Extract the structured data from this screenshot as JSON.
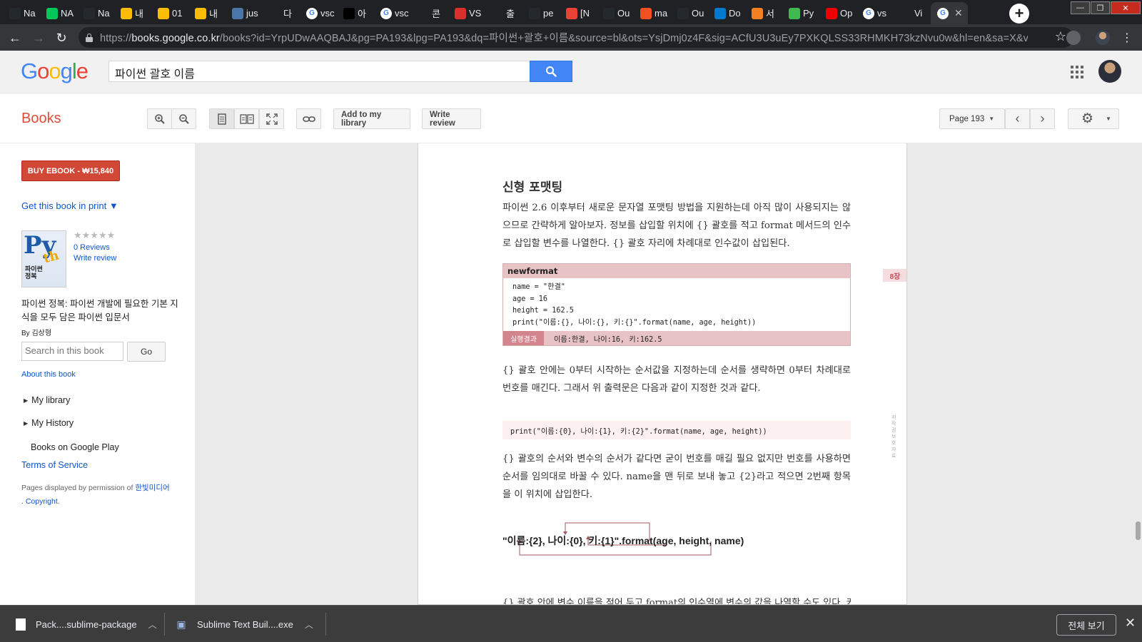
{
  "browser": {
    "tabs": [
      {
        "icon": "github-icon",
        "label": "Na",
        "color": "#24292e"
      },
      {
        "icon": "naver-icon",
        "label": "NA",
        "color": "#03c75a"
      },
      {
        "icon": "github-icon",
        "label": "Na",
        "color": "#24292e"
      },
      {
        "icon": "drive-icon",
        "label": "내",
        "color": "#fbbc04"
      },
      {
        "icon": "drive-icon",
        "label": "01",
        "color": "#fbbc04"
      },
      {
        "icon": "drive-icon",
        "label": "내",
        "color": "#fbbc04"
      },
      {
        "icon": "vk-icon",
        "label": "jus",
        "color": "#4a76a8"
      },
      {
        "icon": "download-icon",
        "label": "다",
        "color": "#202124"
      },
      {
        "icon": "google-icon",
        "label": "vsc",
        "color": "#ffffff"
      },
      {
        "icon": "dev-icon",
        "label": "아",
        "color": "#000000"
      },
      {
        "icon": "google-icon",
        "label": "vsc",
        "color": "#ffffff"
      },
      {
        "icon": "blank-icon",
        "label": "콘",
        "color": "#202124"
      },
      {
        "icon": "vs-icon",
        "label": "VS",
        "color": "#d9302c"
      },
      {
        "icon": "blank-icon",
        "label": "출",
        "color": "#202124"
      },
      {
        "icon": "github-icon",
        "label": "pe",
        "color": "#24292e"
      },
      {
        "icon": "gmail-icon",
        "label": "[N",
        "color": "#ea4335"
      },
      {
        "icon": "github-icon",
        "label": "Ou",
        "color": "#24292e"
      },
      {
        "icon": "microsoft-icon",
        "label": "ma",
        "color": "#f25022"
      },
      {
        "icon": "github-icon",
        "label": "Ou",
        "color": "#24292e"
      },
      {
        "icon": "vscode-icon",
        "label": "Do",
        "color": "#007acc"
      },
      {
        "icon": "stack-icon",
        "label": "서",
        "color": "#f48024"
      },
      {
        "icon": "py-icon",
        "label": "Py",
        "color": "#3fb950"
      },
      {
        "icon": "k-icon",
        "label": "Op",
        "color": "#e00"
      },
      {
        "icon": "google-icon",
        "label": "vs",
        "color": "#ffffff"
      },
      {
        "icon": "code-icon",
        "label": "Vi",
        "color": "#202124"
      },
      {
        "icon": "google-icon",
        "label": "",
        "color": "#ffffff",
        "active": true
      }
    ],
    "url_scheme": "https://",
    "url_host": "books.google.co.kr",
    "url_rest": "/books?id=YrpUDwAAQBAJ&pg=PA193&lpg=PA193&dq=파이썬+괄호+이름&source=bl&ots=YsjDmj0z4F&sig=ACfU3U3uEy7PXKQLSS33RHMKH73kzNvu0w&hl=en&sa=X&ved..."
  },
  "google": {
    "logo_letters": [
      {
        "ch": "G",
        "color": "#4285f4"
      },
      {
        "ch": "o",
        "color": "#ea4335"
      },
      {
        "ch": "o",
        "color": "#fbbc05"
      },
      {
        "ch": "g",
        "color": "#4285f4"
      },
      {
        "ch": "l",
        "color": "#34a853"
      },
      {
        "ch": "e",
        "color": "#ea4335"
      }
    ],
    "search_value": "파이썬 괄호 이름"
  },
  "books_bar": {
    "title": "Books",
    "add_library": "Add to my library",
    "write_review": "Write review",
    "page_label": "Page 193"
  },
  "sidebar": {
    "buy_label": "BUY EBOOK - ₩15,840",
    "get_print": "Get this book in print ▼",
    "stars": "★★★★★",
    "reviews": "0 Reviews",
    "write_review": "Write review",
    "book_title": "파이썬 정복: 파이썬 개발에 필요한 기본 지식을 모두 담은 파이썬 입문서",
    "author": "By 김상형",
    "search_placeholder": "Search in this book",
    "go_label": "Go",
    "about": "About this book",
    "my_library": "My library",
    "my_history": "My History",
    "google_play": "Books on Google Play",
    "tos": "Terms of Service",
    "perm_prefix": "Pages displayed by permission of ",
    "perm_publisher": "한빛미디어",
    "perm_copyright": ". Copyright",
    "perm_end": "."
  },
  "page": {
    "heading": "신형 포맷팅",
    "para1": "파이썬 2.6 이후부터 새로운 문자열 포맷팅 방법을 지원하는데 아직 많이 사용되지는 않으므로 간략하게 알아보자. 정보를 삽입할 위치에 {} 괄호를 적고 format 메서드의 인수로 삽입할 변수를 나열한다. {} 괄호 자리에 차례대로 인수값이 삽입된다.",
    "code_title": "newformat",
    "code_lines": "name = \"한결\"\nage = 16\nheight = 162.5\nprint(\"이름:{}, 나이:{}, 키:{}\".format(name, age, height))",
    "result_label": "실행결과",
    "result_value": "이름:한결, 나이:16, 키:162.5",
    "chapter": "8장",
    "para2": "{} 괄호 안에는 0부터 시작하는 순서값을 지정하는데 순서를 생략하면 0부터 차례대로 번호를 매긴다. 그래서 위 출력문은 다음과 같이 지정한 것과 같다.",
    "code2": "print(\"이름:{0}, 나이:{1}, 키:{2}\".format(name, age, height))",
    "side_note": "저작권 보호 자료",
    "para3": "{} 괄호의 순서와 변수의 순서가 같다면 굳이 번호를 매길 필요 없지만 번호를 사용하면 순서를 임의대로 바꿀 수 있다. name을 맨 뒤로 보내 놓고 {2}라고 적으면 2번째 항목을 이 위치에 삽입한다.",
    "diagram_text": "\"이름:{2}, 나이:{0}, 키:{1}\".format(age, height, name)",
    "cut_line": "{} 괄호 안에 변수 이름을 적어 두고 format의 인수열에 변수의 값을 나열할 수도 있다. 키워"
  },
  "downloads": {
    "item1": "Pack....sublime-package",
    "item2": "Sublime Text Buil....exe",
    "show_all": "전체 보기"
  }
}
